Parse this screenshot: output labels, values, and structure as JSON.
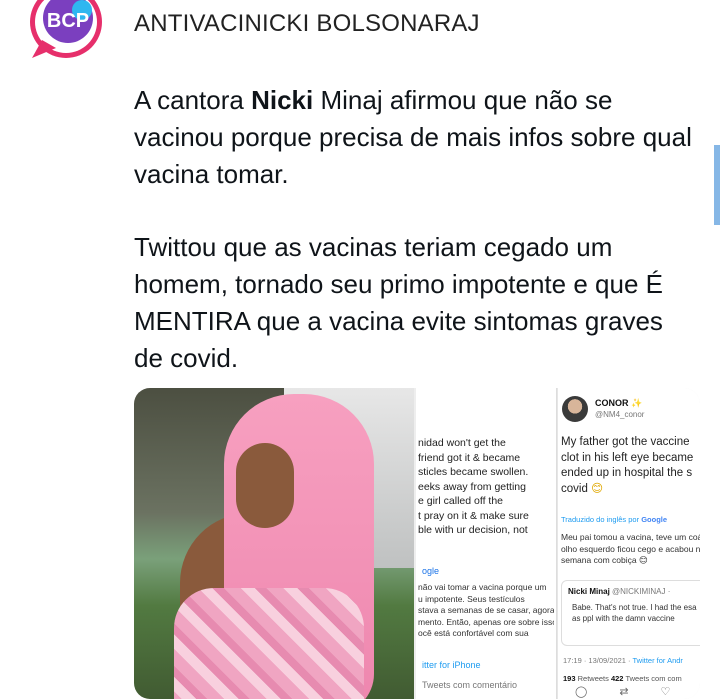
{
  "profile": {
    "logo_text": "BCP",
    "handle": "ANTIVACINICKI BOLSONARAJ"
  },
  "tweet": {
    "para1_before": "A cantora ",
    "para1_bold": "Nicki",
    "para1_after": " Minaj afirmou que não se vacinou porque precisa de mais infos sobre qual vacina tomar.",
    "para2": "Twittou que as vacinas teriam cegado um homem, tornado seu primo impotente e que É MENTIRA que a vacina evite sintomas graves de covid."
  },
  "screenshot1": {
    "lines": [
      "nidad won't get the",
      "friend got it & became",
      "sticles became swollen.",
      "eeks away from getting",
      "e girl called off the",
      "t pray on it & make sure",
      "ble with ur decision, not"
    ],
    "google_label": "ogle",
    "translated_lines": [
      "não vai tomar a vacina porque um",
      "u impotente. Seus testículos",
      "stava a semanas de se casar, agora a",
      "mento. Então, apenas ore sobre isso",
      "ocê está confortável com sua"
    ],
    "via": "itter for iPhone",
    "comment": "Tweets com comentário"
  },
  "screenshot2": {
    "name": "CONOR",
    "name_star": "✨",
    "handle": "@NM4_conor",
    "english_lines": [
      "My father got the vaccine",
      "clot in his left eye became",
      "ended up in hospital the s",
      "covid"
    ],
    "emoji": "😊",
    "translate_prefix": "Traduzido do inglês por",
    "translate_brand": "Google",
    "pt_lines": [
      "Meu pai tomou a vacina, teve um coá",
      "olho esquerdo ficou cego e acabou n",
      "semana com cobiça 😊"
    ],
    "quote_name": "Nicki Minaj",
    "quote_handle": "@NICKIMINAJ ·",
    "quote_lines": [
      "Babe. That's not true. I had the esa",
      "as ppl with the damn vaccine"
    ],
    "meta_time": "17:19 · 13/09/2021 · ",
    "meta_source": "Twitter for Andr",
    "retweets_count": "193",
    "retweets_label": "Retweets",
    "quotes_count": "422",
    "quotes_label": "Tweets com com"
  }
}
